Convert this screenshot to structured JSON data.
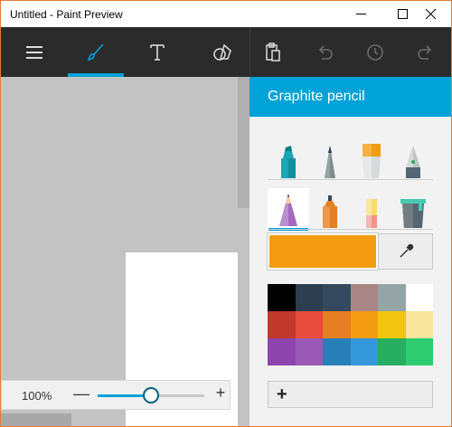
{
  "window": {
    "title": "Untitled - Paint Preview",
    "controls": {
      "minimize": "minimize-icon",
      "maximize": "maximize-icon",
      "close": "close-icon"
    }
  },
  "toolbar": {
    "tools": [
      {
        "name": "menu",
        "icon": "hamburger-icon"
      },
      {
        "name": "brushes",
        "icon": "brush-icon",
        "active": true
      },
      {
        "name": "text",
        "icon": "text-icon"
      },
      {
        "name": "shapes",
        "icon": "shapes-icon"
      },
      {
        "name": "paste",
        "icon": "clipboard-icon"
      },
      {
        "name": "undo",
        "icon": "undo-icon",
        "disabled": true
      },
      {
        "name": "history",
        "icon": "history-icon",
        "disabled": true
      },
      {
        "name": "redo",
        "icon": "redo-icon",
        "disabled": true
      }
    ],
    "accent": "#00a2d8"
  },
  "zoom": {
    "label": "100%",
    "minus": "—",
    "plus": "+",
    "level_fraction": 0.5
  },
  "panel": {
    "title": "Graphite pencil",
    "brushes_row1": [
      "marker",
      "calligraphy-pen",
      "oil-brush",
      "fountain-pen"
    ],
    "brushes_row2": [
      "graphite-pencil",
      "spray-can",
      "eraser",
      "paint-bucket"
    ],
    "selected_brush": "graphite-pencil",
    "current_color": "#f39c12",
    "palette": [
      "#000000",
      "#2c3e50",
      "#34495e",
      "#a98787",
      "#95a5a6",
      "#ffffff",
      "#c0392b",
      "#e74c3c",
      "#e67e22",
      "#f39c12",
      "#f1c40f",
      "#f9e79f",
      "#8e44ad",
      "#9b59b6",
      "#2980b9",
      "#3498db",
      "#27ae60",
      "#2ecc71"
    ],
    "add_label": "+"
  }
}
